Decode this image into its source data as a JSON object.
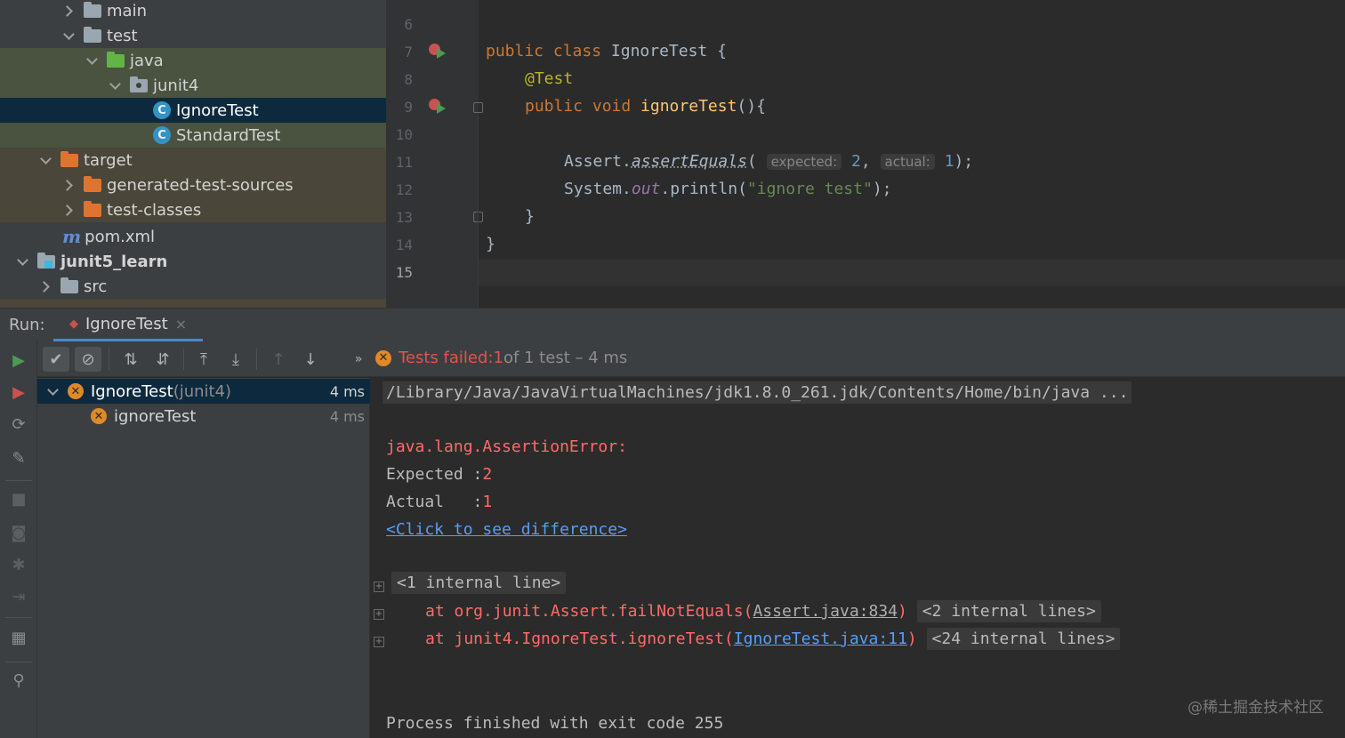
{
  "project_tree": {
    "items": [
      {
        "label": "main"
      },
      {
        "label": "test"
      },
      {
        "label": "java"
      },
      {
        "label": "junit4"
      },
      {
        "label": "IgnoreTest"
      },
      {
        "label": "StandardTest"
      },
      {
        "label": "target"
      },
      {
        "label": "generated-test-sources"
      },
      {
        "label": "test-classes"
      },
      {
        "label": "pom.xml"
      },
      {
        "label": "junit5_learn"
      },
      {
        "label": "src"
      }
    ],
    "class_icon_letter": "C",
    "maven_icon_letter": "m"
  },
  "editor": {
    "line_numbers": [
      "6",
      "7",
      "8",
      "9",
      "10",
      "11",
      "12",
      "13",
      "14",
      "15"
    ],
    "code": {
      "l7_kw": "public class ",
      "l7_name": "IgnoreTest {",
      "l8_ann": "@Test",
      "l9_kw": "public void ",
      "l9_method": "ignoreTest",
      "l9_rest": "(){",
      "l11_obj": "Assert.",
      "l11_call": "assertEquals",
      "l11_open": "(",
      "l11_hint_expected": "expected:",
      "l11_val_expected": "2",
      "l11_comma": ", ",
      "l11_hint_actual": "actual:",
      "l11_val_actual": "1",
      "l11_close": ");",
      "l12_obj": "System.",
      "l12_field": "out",
      "l12_call": ".println(",
      "l12_str": "\"ignore test\"",
      "l12_close": ");",
      "l13": "}",
      "l14": "}"
    }
  },
  "run_panel": {
    "label": "Run:",
    "tab_label": "IgnoreTest",
    "tab_close": "×",
    "status": {
      "failed_label": "Tests failed: ",
      "failed_count": "1",
      "rest": " of 1 test – 4 ms"
    },
    "results": [
      {
        "name": "IgnoreTest",
        "suffix": " (junit4)",
        "time": "4 ms"
      },
      {
        "name": "ignoreTest",
        "time": "4 ms"
      }
    ]
  },
  "console": {
    "command": "/Library/Java/JavaVirtualMachines/jdk1.8.0_261.jdk/Contents/Home/bin/java ...",
    "error_class": "java.lang.AssertionError:",
    "expected_label": "Expected :",
    "expected_value": "2",
    "actual_label": "Actual   :",
    "actual_value": "1",
    "diff_link": "<Click to see difference>",
    "internal_line": "<1 internal line>",
    "trace1_prefix": "at org.junit.Assert.failNotEquals(",
    "trace1_link": "Assert.java:834",
    "trace1_suffix": ")",
    "trace1_fold": "<2 internal lines>",
    "trace2_prefix": "at junit4.IgnoreTest.ignoreTest(",
    "trace2_link": "IgnoreTest.java:11",
    "trace2_suffix": ")",
    "trace2_fold": "<24 internal lines>",
    "exit": "Process finished with exit code 255"
  },
  "watermark": "@稀土掘金技术社区",
  "colors": {
    "accent": "#4a88c7",
    "fail": "#e0544d",
    "warning_badge": "#e08a27",
    "selection": "#0d293e"
  }
}
